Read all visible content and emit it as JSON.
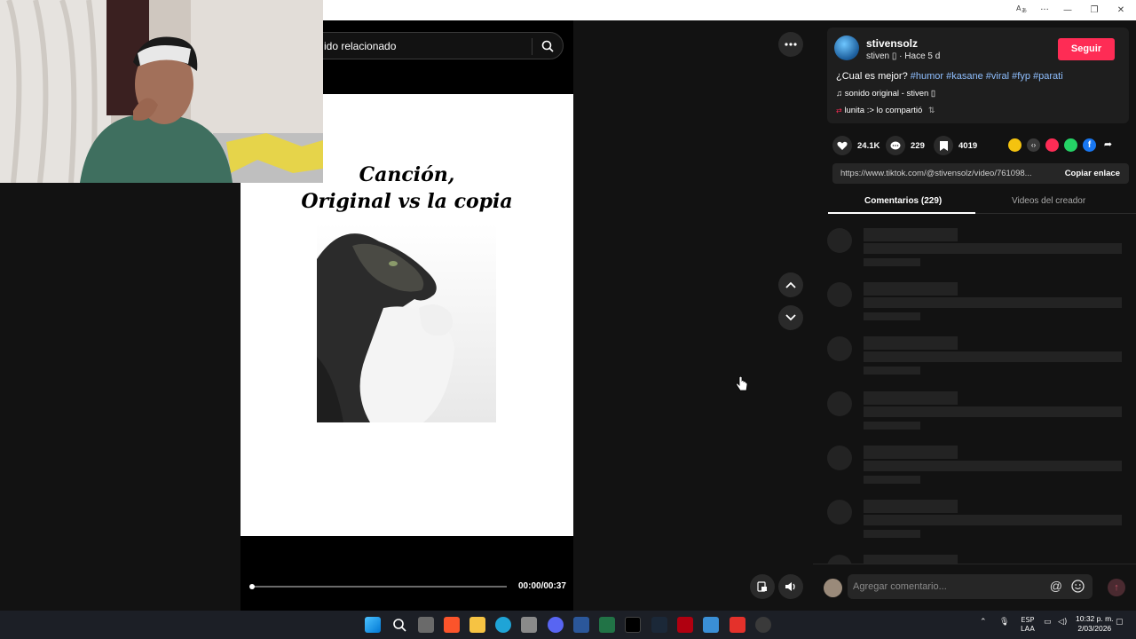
{
  "window": {
    "translate_icon": "translate-icon",
    "more": "···",
    "minimize": "—",
    "restore": "❐",
    "close": "✕"
  },
  "search": {
    "text": "ido relacionado",
    "icon": "search-icon"
  },
  "video": {
    "title_line1": "Canción,",
    "title_line2": "Original vs la copia",
    "time": "00:00/00:37",
    "progress": 0.01
  },
  "author": {
    "username": "stivensolz",
    "subtitle": "stiven ▯ · Hace 5 d",
    "follow_label": "Seguir"
  },
  "description": {
    "text": "¿Cual es mejor?",
    "hashtags": [
      "#humor",
      "#kasane",
      "#viral",
      "#fyp",
      "#parati"
    ]
  },
  "sound": "♫  sonido original - stiven ▯",
  "shared": "lunita :> lo compartió",
  "stats": {
    "likes": "24.1K",
    "comments": "229",
    "saves": "4019"
  },
  "link": {
    "url": "https://www.tiktok.com/@stivensolz/video/761098...",
    "copy_label": "Copiar enlace"
  },
  "tabs": {
    "comments": "Comentarios (229)",
    "creator": "Videos del creador"
  },
  "comment_input": {
    "placeholder": "Agregar comentario..."
  },
  "taskbar": {
    "lang_line1": "ESP",
    "lang_line2": "LAA",
    "time": "10:32 p. m.",
    "date": "2/03/2026"
  },
  "colors": {
    "accent": "#fe2c55",
    "hashtag": "#8fbfff",
    "background": "#121212"
  }
}
